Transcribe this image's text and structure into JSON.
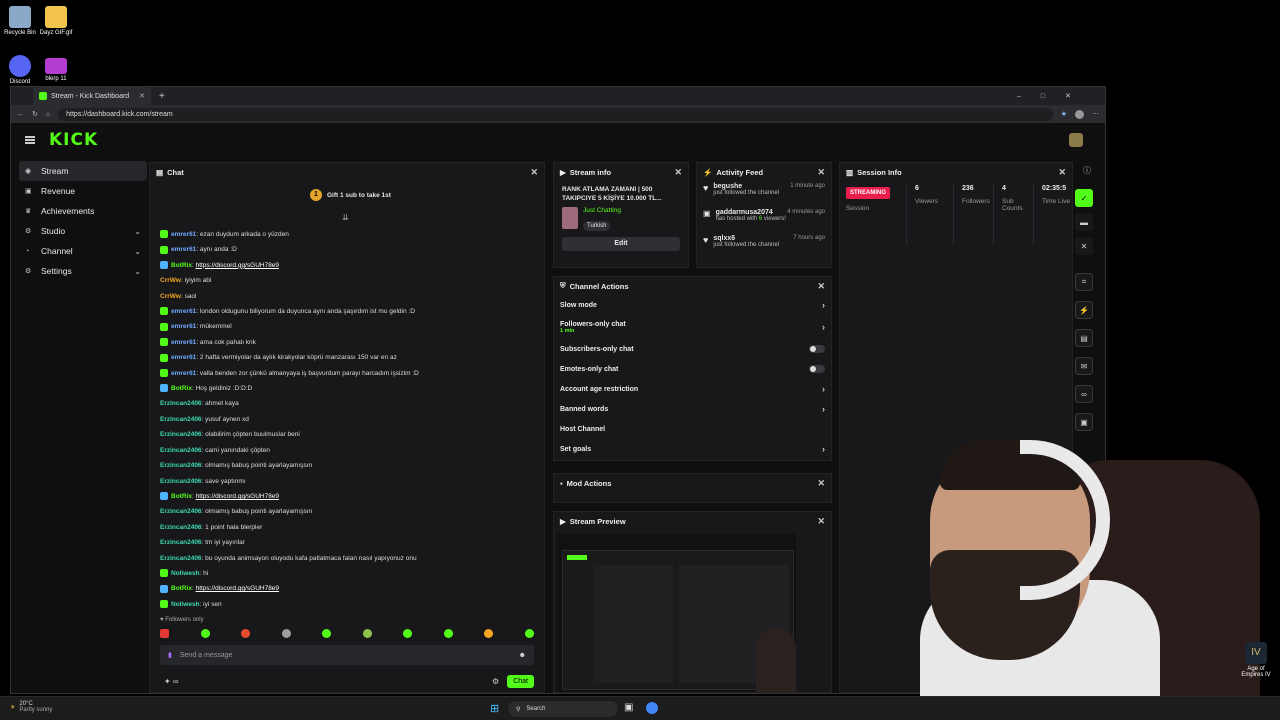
{
  "desktop": {
    "icons": [
      {
        "label": "Recycle Bin"
      },
      {
        "label": "Dayz GIF.gif"
      },
      {
        "label": "Discord"
      },
      {
        "label": "blerp 11"
      }
    ],
    "age_icon_label": "Age of Empires IV"
  },
  "browser": {
    "tab_title": "Stream - Kick Dashboard",
    "url": "https://dashboard.kick.com/stream"
  },
  "sidebar": {
    "items": [
      {
        "label": "Stream"
      },
      {
        "label": "Revenue"
      },
      {
        "label": "Achievements"
      },
      {
        "label": "Studio"
      },
      {
        "label": "Channel"
      },
      {
        "label": "Settings"
      }
    ]
  },
  "chat": {
    "title": "Chat",
    "gift_banner": "Gift 1 sub to take 1st",
    "messages": [
      {
        "user": "emrer61",
        "text": ": ezan duydum arkada o yüzden"
      },
      {
        "user": "emrer61",
        "text": ": aynı anda :D"
      },
      {
        "user": "BotRix",
        "text": "https://discord.gg/sGUH78e9"
      },
      {
        "user": "CrrWw",
        "text": ": iyiyim abi"
      },
      {
        "user": "CrrWw",
        "text": ": saol"
      },
      {
        "user": "emrer61",
        "text": ": london oldugunu biliyorum da duyunca aynı anda şaşırdım ist mu geldin :D"
      },
      {
        "user": "emrer61",
        "text": ": mükemmel"
      },
      {
        "user": "emrer61",
        "text": ": ama cok pahalı knk"
      },
      {
        "user": "emrer61",
        "text": ": 2 hafta vermiyolar da aylık kirakyolar köprü manzarası 150 var en az"
      },
      {
        "user": "emrer61",
        "text": ": valla benden zor çünkü almanyaya iş başvurdum parayı harcadım işsizim :D"
      },
      {
        "user": "BotRix",
        "text": ": Hoş geldiniz :D:D:D"
      },
      {
        "user": "Erzincan2406",
        "text": ": ahmet kaya"
      },
      {
        "user": "Erzincan2406",
        "text": ": yusuf aynen xd"
      },
      {
        "user": "Erzincan2406",
        "text": ": olabilirim çöpten buulmuslar beni"
      },
      {
        "user": "Erzincan2406",
        "text": ": cami yanındaki çöpten"
      },
      {
        "user": "Erzincan2406",
        "text": ": olmamış babuş pointi ayarlayamışsın"
      },
      {
        "user": "Erzincan2406",
        "text": ": save yaptınmı"
      },
      {
        "user": "BotRix",
        "text": "https://discord.gg/sGUH78e9"
      },
      {
        "user": "Erzincan2406",
        "text": ": olmamış babuş pointi ayarlayamışsın"
      },
      {
        "user": "Erzincan2406",
        "text": ": 1 point hala blerpler"
      },
      {
        "user": "Erzincan2406",
        "text": ": tm iyi yayınlar"
      },
      {
        "user": "Erzincan2406",
        "text": ": bu oyunda animsayon oluyodu kafa patlatmaca falan nasıl yapıyonuz onu"
      },
      {
        "user": "Noliwesh",
        "text": ": hi"
      },
      {
        "user": "BotRix",
        "text": "https://discord.gg/sGUH78e9"
      },
      {
        "user": "Noliwesh",
        "text": ": iyi sen"
      }
    ],
    "followers_only": "Followers only",
    "placeholder": "Send a message",
    "send_label": "Chat"
  },
  "stream_info": {
    "title": "Stream info",
    "stream_title": "RANK ATLAMA ZAMANI | 500 TAKIPCIYE 5 KİŞİYE 10.000 TL...",
    "category": "Just Chatting",
    "language": "Turkish",
    "edit_label": "Edit"
  },
  "activity_feed": {
    "title": "Activity Feed",
    "items": [
      {
        "user": "begushe",
        "time": "1 minute ago",
        "desc": "just followed the channel"
      },
      {
        "user": "gaddarmusa2074",
        "time": "4 minutes ago",
        "desc_pre": "has hosted with ",
        "count": "6",
        "desc_post": " viewers!"
      },
      {
        "user": "sqlxx6",
        "time": "7 hours ago",
        "desc": "just followed the channel"
      }
    ]
  },
  "session_info": {
    "title": "Session Info",
    "badge": "STREAMING",
    "session_label": "Session",
    "stats": [
      {
        "value": "6",
        "label": "Viewers"
      },
      {
        "value": "236",
        "label": "Followers"
      },
      {
        "value": "4",
        "label": "Sub Counts"
      },
      {
        "value": "02:35:5",
        "label": "Time Live"
      }
    ]
  },
  "channel_actions": {
    "title": "Channel Actions",
    "rows": [
      {
        "label": "Slow mode"
      },
      {
        "label": "Followers-only chat",
        "sub": "1 min"
      },
      {
        "label": "Subscribers-only chat"
      },
      {
        "label": "Emotes-only chat"
      },
      {
        "label": "Account age restriction"
      },
      {
        "label": "Banned words"
      },
      {
        "label": "Host Channel"
      },
      {
        "label": "Set goals"
      }
    ]
  },
  "mod_actions": {
    "title": "Mod Actions"
  },
  "stream_preview": {
    "title": "Stream Preview"
  },
  "taskbar": {
    "temp": "20°C",
    "weather": "Partly sunny",
    "search": "Search"
  },
  "colors": {
    "accent": "#53fc18",
    "live": "#e91e4d",
    "bg": "#0f0f10",
    "panel": "#18181b"
  }
}
